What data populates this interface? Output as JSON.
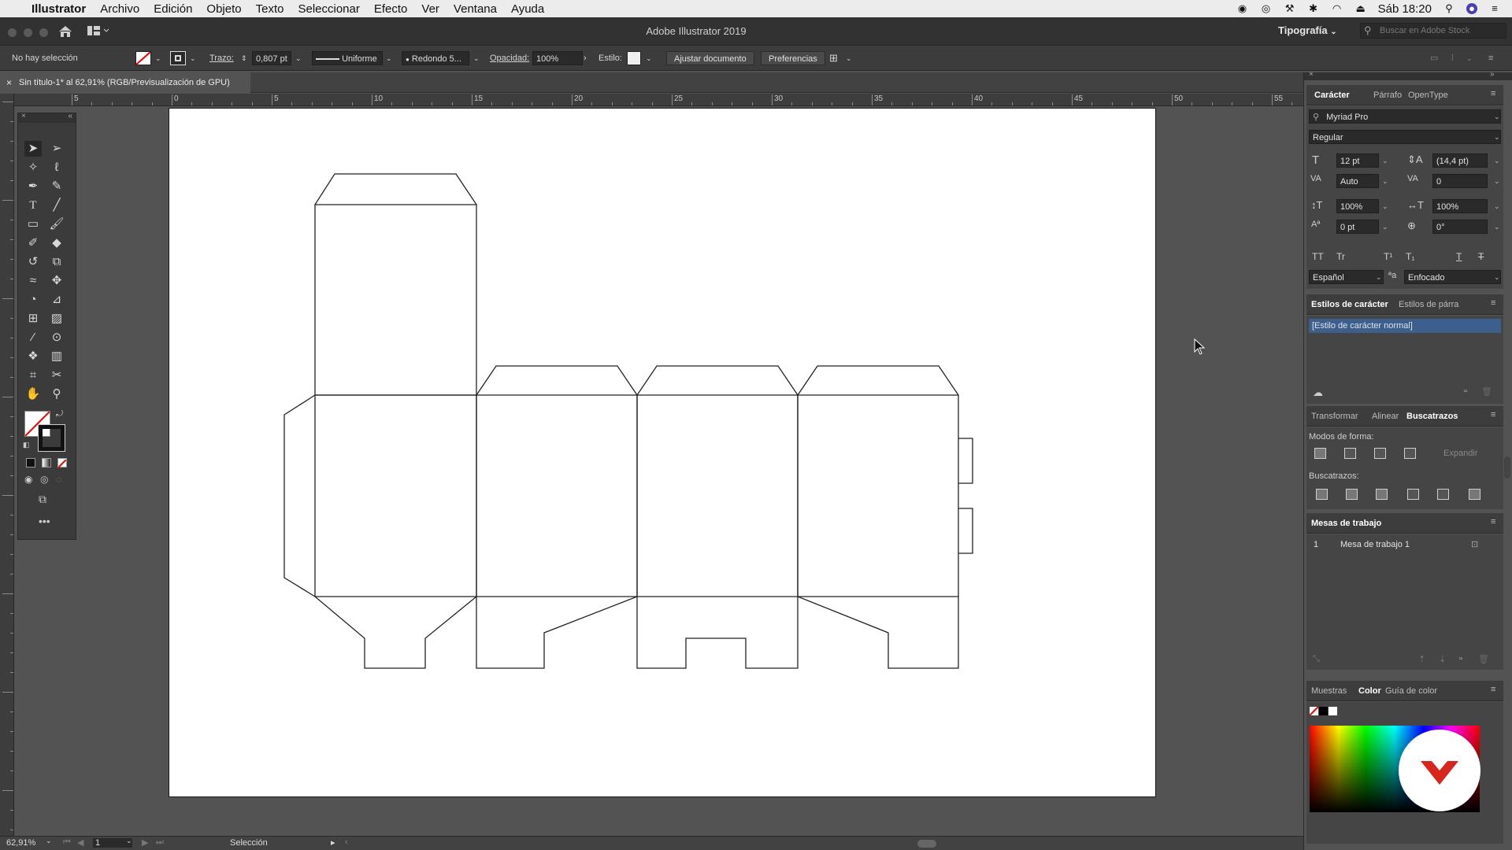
{
  "menubar": {
    "app": "Illustrator",
    "items": [
      "Archivo",
      "Edición",
      "Objeto",
      "Texto",
      "Seleccionar",
      "Efecto",
      "Ver",
      "Ventana",
      "Ayuda"
    ],
    "clock": "Sáb 18:20"
  },
  "titlebar": {
    "title": "Adobe Illustrator 2019",
    "workspace": "Tipografía",
    "search_placeholder": "Buscar en Adobe Stock"
  },
  "control": {
    "selection": "No hay selección",
    "stroke_label": "Trazo:",
    "stroke_value": "0,807 pt",
    "profile": "Uniforme",
    "brush": "Redondo 5...",
    "opacity_label": "Opacidad:",
    "opacity_value": "100%",
    "style_label": "Estilo:",
    "fit_button": "Ajustar documento",
    "prefs_button": "Preferencias"
  },
  "document": {
    "tab_title": "Sin título-1* al 62,91% (RGB/Previsualización de GPU)",
    "ruler_labels": [
      "5",
      "0",
      "5",
      "10",
      "15",
      "20",
      "25",
      "30",
      "35",
      "40",
      "45",
      "50",
      "55"
    ]
  },
  "character_panel": {
    "tabs": [
      "Carácter",
      "Párrafo",
      "OpenType"
    ],
    "font": "Myriad Pro",
    "style": "Regular",
    "size": "12 pt",
    "leading": "(14,4 pt)",
    "kerning": "Auto",
    "tracking": "0",
    "vscale": "100%",
    "hscale": "100%",
    "baseline": "0 pt",
    "rotation": "0°",
    "language": "Español",
    "antialias": "Enfocado"
  },
  "styles_panel": {
    "tabs": [
      "Estilos de carácter",
      "Estilos de párra"
    ],
    "selected": "[Estilo de carácter normal]"
  },
  "pathfinder_panel": {
    "tabs": [
      "Transformar",
      "Alinear",
      "Buscatrazos"
    ],
    "shape_modes_label": "Modos de forma:",
    "expand_button": "Expandir",
    "pathfinders_label": "Buscatrazos:"
  },
  "artboards_panel": {
    "title": "Mesas de trabajo",
    "rows": [
      {
        "num": "1",
        "name": "Mesa de trabajo 1"
      }
    ]
  },
  "color_panel": {
    "tabs": [
      "Muestras",
      "Color",
      "Guía de color"
    ]
  },
  "status": {
    "zoom": "62,91%",
    "artboard_num": "1",
    "tool": "Selección"
  },
  "colors": {
    "ui_dark": "#323232",
    "canvas_bg": "#535353",
    "selection_blue": "#3d5f8e",
    "logo_red": "#d8261f"
  }
}
